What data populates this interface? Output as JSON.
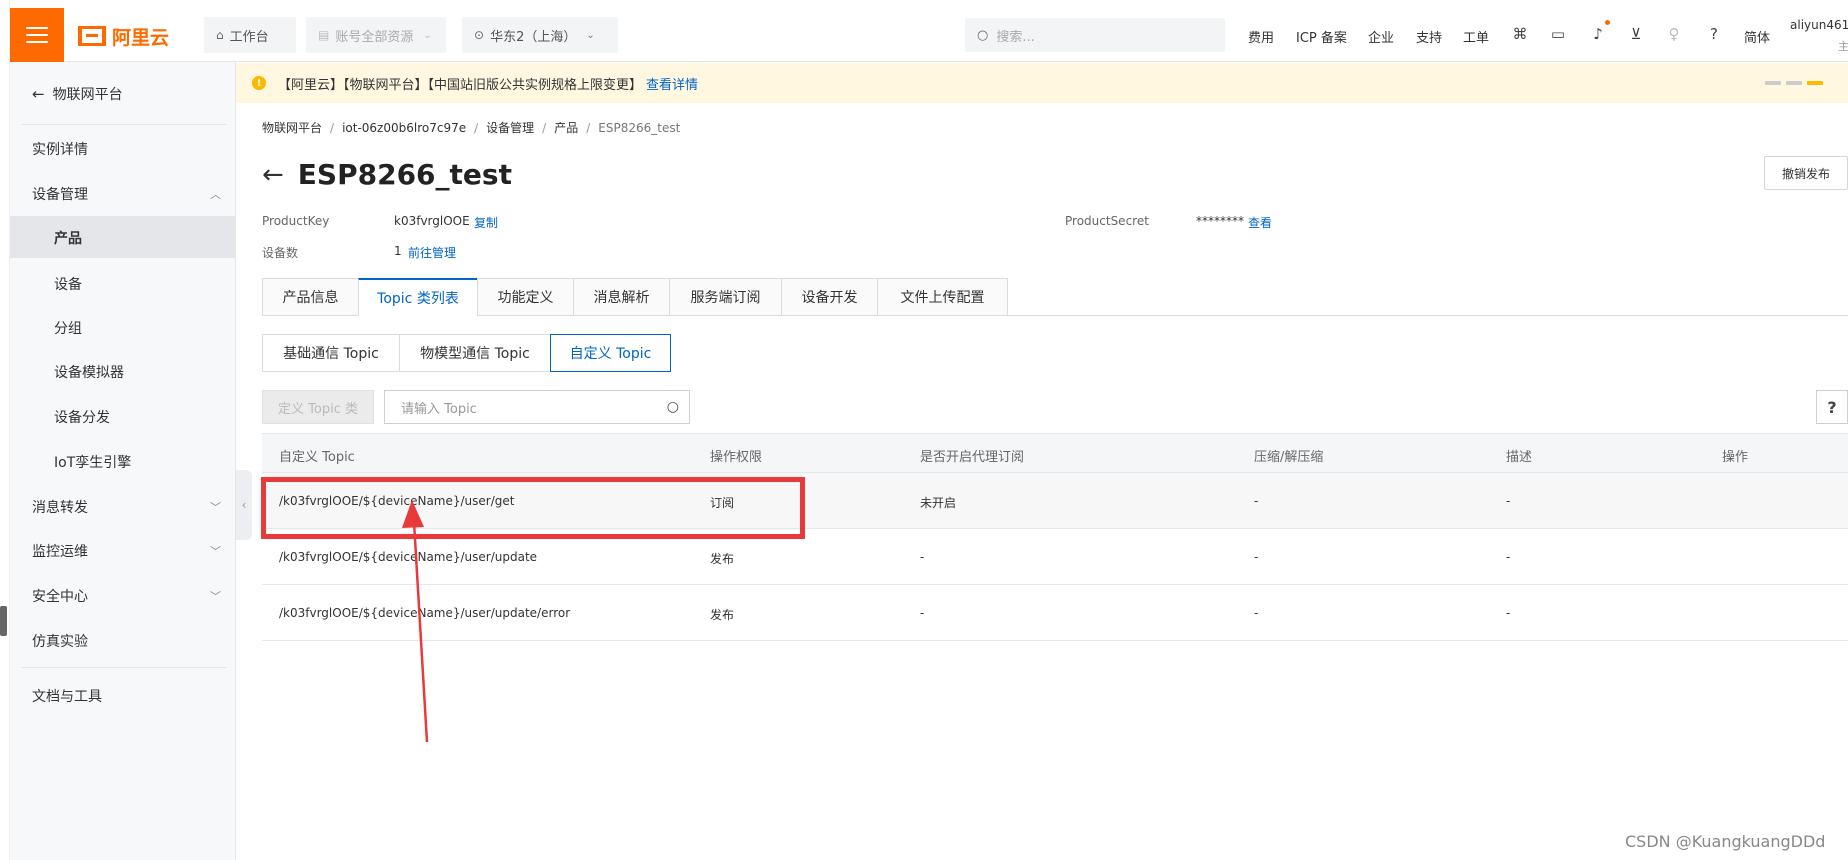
{
  "topnav": {
    "logo_text": "阿里云",
    "workbench": "工作台",
    "resources": "账号全部资源",
    "region": "华东2（上海）",
    "search_placeholder": "搜索...",
    "links": [
      "费用",
      "ICP 备案",
      "企业",
      "支持",
      "工单"
    ],
    "lang": "简体",
    "user": "aliyun461",
    "user_sub": "主"
  },
  "notice": {
    "text": "【阿里云】【物联网平台】【中国站旧版公共实例规格上限变更】",
    "link": "查看详情"
  },
  "sidebar": {
    "back": "物联网平台",
    "items": [
      "实例详情",
      "设备管理",
      "产品",
      "设备",
      "分组",
      "设备模拟器",
      "设备分发",
      "IoT孪生引擎",
      "消息转发",
      "监控运维",
      "安全中心",
      "仿真实验",
      "文档与工具"
    ]
  },
  "breadcrumb": [
    "物联网平台",
    "iot-06z00b6lro7c97e",
    "设备管理",
    "产品",
    "ESP8266_test"
  ],
  "product": {
    "title": "ESP8266_test",
    "revoke_button": "撤销发布",
    "productkey_label": "ProductKey",
    "productkey_value": "k03fvrglOOE",
    "copy_link": "复制",
    "devices_label": "设备数",
    "devices_value": "1",
    "manage_link": "前往管理",
    "secret_label": "ProductSecret",
    "secret_value": "********",
    "view_link": "查看"
  },
  "tabs": [
    "产品信息",
    "Topic 类列表",
    "功能定义",
    "消息解析",
    "服务端订阅",
    "设备开发",
    "文件上传配置"
  ],
  "subtabs": [
    "基础通信 Topic",
    "物模型通信 Topic",
    "自定义 Topic"
  ],
  "toolbar": {
    "define_button": "定义 Topic 类",
    "topic_placeholder": "请输入 Topic",
    "help": "?"
  },
  "table": {
    "headers": [
      "自定义 Topic",
      "操作权限",
      "是否开启代理订阅",
      "压缩/解压缩",
      "描述",
      "操作"
    ],
    "rows": [
      [
        "/k03fvrglOOE/${deviceName}/user/get",
        "订阅",
        "未开启",
        "-",
        "-"
      ],
      [
        "/k03fvrglOOE/${deviceName}/user/update",
        "发布",
        "-",
        "-",
        "-"
      ],
      [
        "/k03fvrglOOE/${deviceName}/user/update/error",
        "发布",
        "-",
        "-",
        "-"
      ]
    ]
  },
  "watermark": "CSDN @KuangkuangDDd",
  "colors": {
    "brand": "#ff6a00",
    "link": "#0064c8",
    "annotation": "#e8393b",
    "notice_bg": "#fff7e0"
  }
}
